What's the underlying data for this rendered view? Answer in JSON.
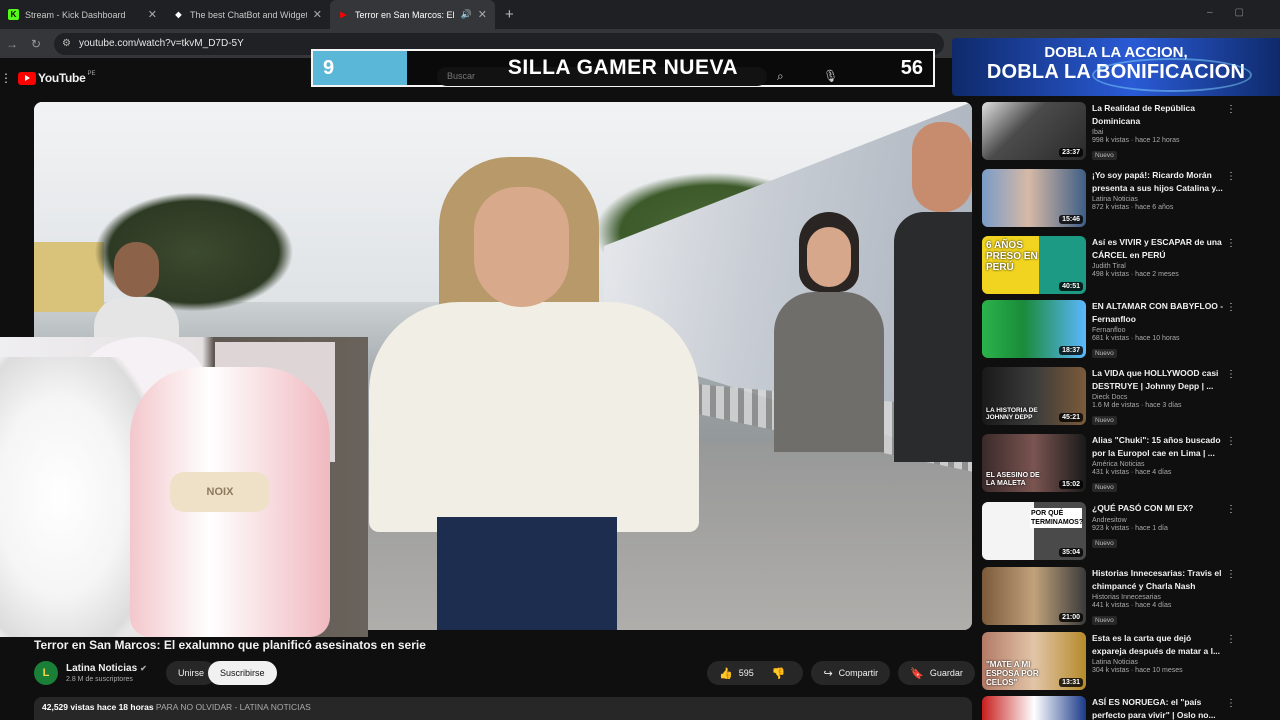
{
  "browser": {
    "tabs": [
      {
        "title": "Stream - Kick Dashboard",
        "favicon": "K",
        "favicon_color": "#53fc18"
      },
      {
        "title": "The best ChatBot and Widgets",
        "favicon": "◆",
        "favicon_color": "#ffffff"
      },
      {
        "title": "Terror en San Marcos: El ex",
        "favicon": "▶",
        "favicon_color": "#ff0000"
      }
    ],
    "url": "youtube.com/watch?v=tkvM_D7D-5Y"
  },
  "youtube": {
    "logo_text": "YouTube",
    "country": "PE",
    "search_placeholder": "Buscar"
  },
  "overlay": {
    "goal_current": "9",
    "goal_label": "SILLA GAMER NUEVA",
    "goal_target": "56",
    "promo_line1": "DOBLA LA ACCION,",
    "promo_line2": "DOBLA LA BONIFICACION"
  },
  "webcam": {
    "pillow_text": "NOIX"
  },
  "video": {
    "title": "Terror en San Marcos: El exalumno que planificó asesinatos en serie",
    "channel": "Latina Noticias",
    "subscribers": "2.8 M de suscriptores",
    "join_label": "Unirse",
    "subscribe_label": "Suscribirse",
    "likes": "595",
    "share_label": "Compartir",
    "save_label": "Guardar",
    "views": "42,529 vistas",
    "age": "hace 18 horas",
    "desc_snippet": "PARA NO OLVIDAR - LATINA NOTICIAS"
  },
  "sidebar": [
    {
      "title": "La Realidad de República Dominicana",
      "channel": "Ibai",
      "views": "998 k vistas · hace 12 horas",
      "duration": "23:37",
      "badge": "Nuevo"
    },
    {
      "title": "¡Yo soy papá!: Ricardo Morán presenta a sus hijos Catalina y...",
      "channel": "Latina Noticias",
      "views": "872 k vistas · hace 6 años",
      "duration": "15:46",
      "badge": ""
    },
    {
      "title": "Así es VIVIR y ESCAPAR de una CÁRCEL en PERÚ",
      "channel": "Judith Tiral",
      "views": "498 k vistas · hace 2 meses",
      "duration": "40:51",
      "badge": "",
      "thumb_text": "6 AÑOS PRESO EN PERÚ"
    },
    {
      "title": "EN ALTAMAR CON BABYFLOO - Fernanfloo",
      "channel": "Fernanfloo",
      "views": "681 k vistas · hace 10 horas",
      "duration": "18:37",
      "badge": "Nuevo"
    },
    {
      "title": "La VIDA que HOLLYWOOD casi DESTRUYE | Johnny Depp | ...",
      "channel": "Dieck Docs",
      "views": "1.6 M de vistas · hace 3 días",
      "duration": "45:21",
      "badge": "Nuevo",
      "thumb_text": "LA HISTORIA DE JOHNNY DEPP"
    },
    {
      "title": "Alias \"Chuki\": 15 años buscado por la Europol cae en Lima | ...",
      "channel": "América Noticias",
      "views": "431 k vistas · hace 4 días",
      "duration": "15:02",
      "badge": "Nuevo",
      "thumb_text": "EL ASESINO DE LA MALETA"
    },
    {
      "title": "¿QUÉ PASÓ CON MI EX?",
      "channel": "Andresitow",
      "views": "923 k vistas · hace 1 día",
      "duration": "35:04",
      "badge": "Nuevo",
      "thumb_text": "POR QUÉ TERMINAMOS?"
    },
    {
      "title": "Historias Innecesarias: Travis el chimpancé y Charla Nash",
      "channel": "Historias Innecesarias",
      "views": "441 k vistas · hace 4 días",
      "duration": "21:00",
      "badge": "Nuevo"
    },
    {
      "title": "Esta es la carta que dejó expareja después de matar a l...",
      "channel": "Latina Noticias",
      "views": "304 k vistas · hace 10 meses",
      "duration": "13:31",
      "badge": "",
      "thumb_text": "\"MATE A MI ESPOSA POR CELOS\""
    },
    {
      "title": "ASÍ ES NORUEGA: el \"país perfecto para vivir\" | Oslo no...",
      "channel": "",
      "views": "",
      "duration": "",
      "badge": ""
    }
  ]
}
